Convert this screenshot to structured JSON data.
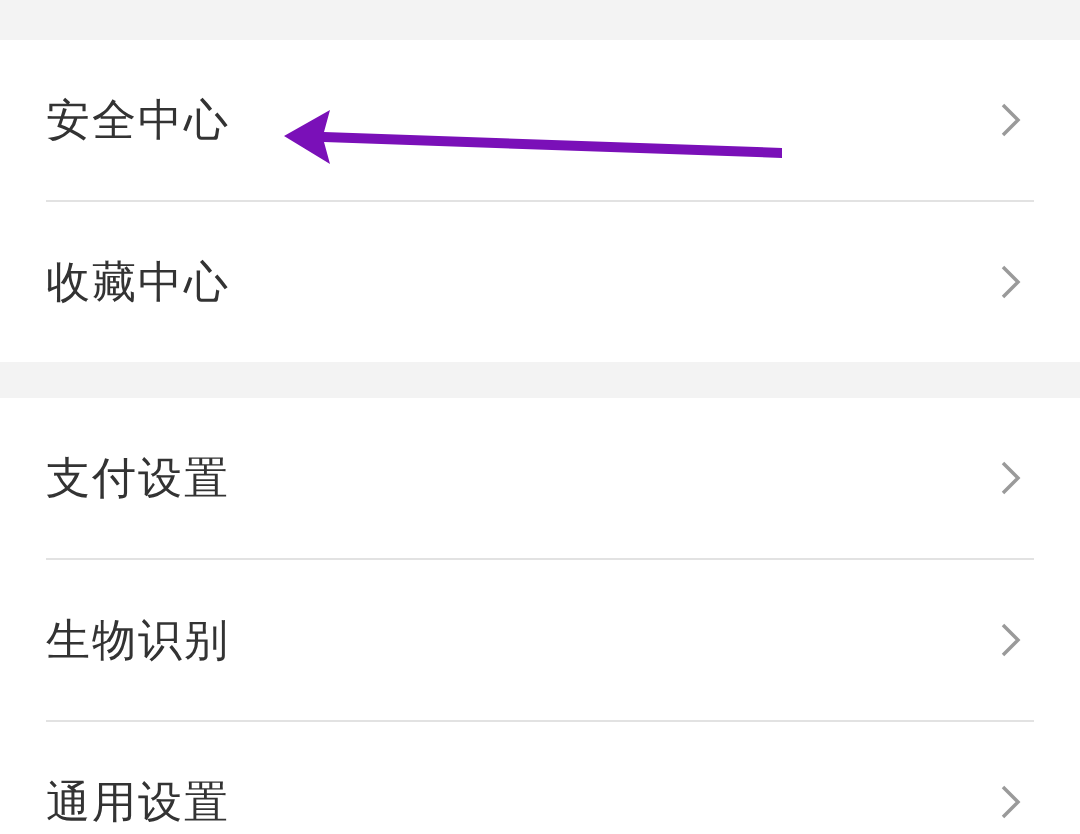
{
  "groups": [
    {
      "items": [
        {
          "label": "安全中心"
        },
        {
          "label": "收藏中心"
        }
      ]
    },
    {
      "items": [
        {
          "label": "支付设置"
        },
        {
          "label": "生物识别"
        },
        {
          "label": "通用设置"
        }
      ]
    }
  ]
}
